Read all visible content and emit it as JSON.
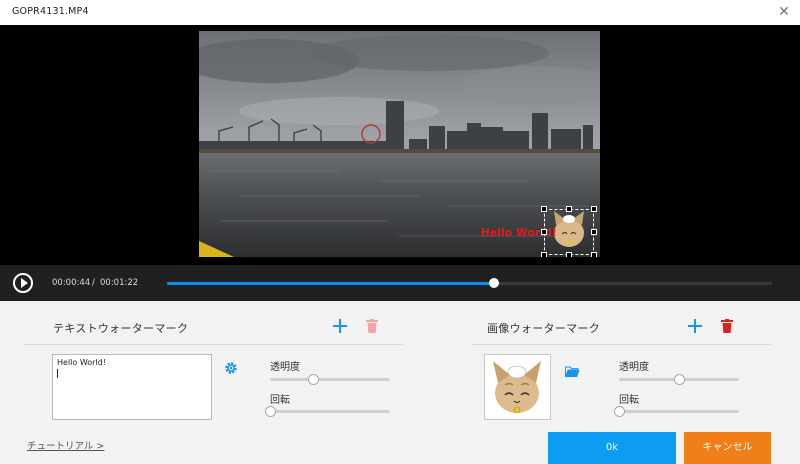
{
  "window": {
    "title": "GOPR4131.MP4",
    "close_glyph": "✕"
  },
  "preview": {
    "text_watermark": "Hello World!",
    "text_watermark_color": "#e8191c",
    "selected_item": "image-watermark"
  },
  "player": {
    "current_time": "00:00:44",
    "separator": "/",
    "total_time": "00:01:22",
    "progress": 0.54,
    "accent": "#0c8ef0"
  },
  "text_watermark": {
    "title": "テキストウォーターマーク",
    "text_value": "Hello World!",
    "opacity_label": "透明度",
    "opacity_value": 0.36,
    "rotation_label": "回転",
    "rotation_value": 0.0,
    "icons": [
      "add-icon",
      "delete-icon",
      "gear-icon"
    ]
  },
  "image_watermark": {
    "title": "画像ウォーターマーク",
    "opacity_label": "透明度",
    "opacity_value": 0.5,
    "rotation_label": "回転",
    "rotation_value": 0.0,
    "icons": [
      "add-icon",
      "delete-icon",
      "folder-icon"
    ]
  },
  "footer": {
    "tutorial_link": "チュートリアル >",
    "ok_label": "0k",
    "cancel_label": "キャンセル",
    "ok_color": "#0e9cf2",
    "cancel_color": "#f07f1a"
  }
}
